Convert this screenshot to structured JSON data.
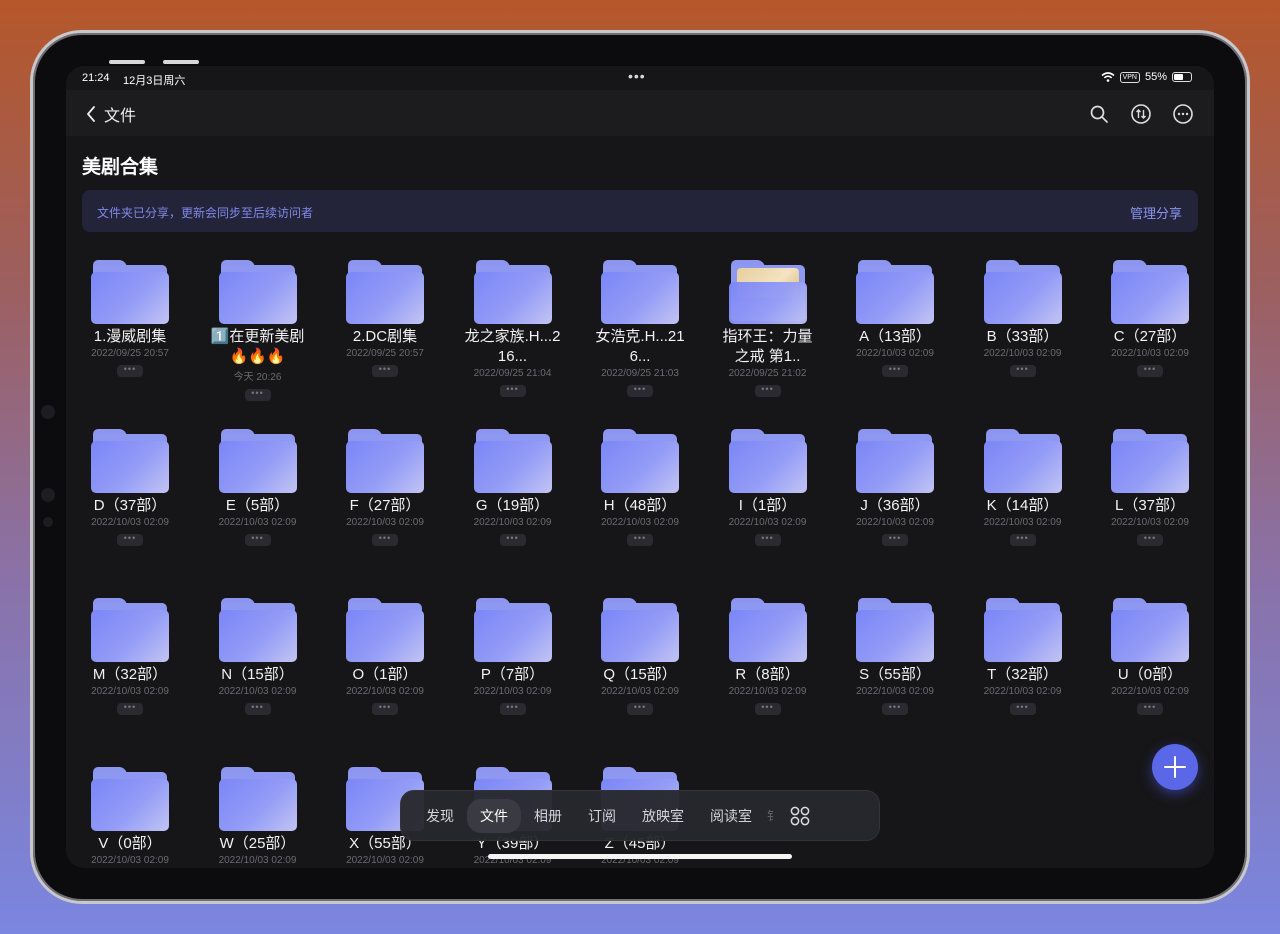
{
  "status": {
    "time": "21:24",
    "date": "12月3日周六",
    "vpn": "VPN",
    "battery": "55%"
  },
  "nav": {
    "back_label": "文件"
  },
  "page": {
    "title": "美剧合集"
  },
  "share": {
    "notice": "文件夹已分享，更新会同步至后续访问者",
    "manage": "管理分享"
  },
  "folders": [
    {
      "name": "1.漫威剧集",
      "date": "2022/09/25 20:57"
    },
    {
      "name": "1️⃣在更新美剧🔥🔥🔥",
      "date": "今天 20:26"
    },
    {
      "name": "2.DC剧集",
      "date": "2022/09/25 20:57"
    },
    {
      "name": "龙之家族.H...216...",
      "date": "2022/09/25 21:04"
    },
    {
      "name": "女浩克.H...216...",
      "date": "2022/09/25 21:03"
    },
    {
      "name": "指环王：力量之戒 第1..",
      "date": "2022/09/25 21:02",
      "photo": true
    },
    {
      "name": "A（13部）",
      "date": "2022/10/03 02:09"
    },
    {
      "name": "B（33部）",
      "date": "2022/10/03 02:09"
    },
    {
      "name": "C（27部）",
      "date": "2022/10/03 02:09"
    },
    {
      "name": "D（37部）",
      "date": "2022/10/03 02:09"
    },
    {
      "name": "E（5部）",
      "date": "2022/10/03 02:09"
    },
    {
      "name": "F（27部）",
      "date": "2022/10/03 02:09"
    },
    {
      "name": "G（19部）",
      "date": "2022/10/03 02:09"
    },
    {
      "name": "H（48部）",
      "date": "2022/10/03 02:09"
    },
    {
      "name": "I（1部）",
      "date": "2022/10/03 02:09"
    },
    {
      "name": "J（36部）",
      "date": "2022/10/03 02:09"
    },
    {
      "name": "K（14部）",
      "date": "2022/10/03 02:09"
    },
    {
      "name": "L（37部）",
      "date": "2022/10/03 02:09"
    },
    {
      "name": "M（32部）",
      "date": "2022/10/03 02:09"
    },
    {
      "name": "N（15部）",
      "date": "2022/10/03 02:09"
    },
    {
      "name": "O（1部）",
      "date": "2022/10/03 02:09"
    },
    {
      "name": "P（7部）",
      "date": "2022/10/03 02:09"
    },
    {
      "name": "Q（15部）",
      "date": "2022/10/03 02:09"
    },
    {
      "name": "R（8部）",
      "date": "2022/10/03 02:09"
    },
    {
      "name": "S（55部）",
      "date": "2022/10/03 02:09"
    },
    {
      "name": "T（32部）",
      "date": "2022/10/03 02:09"
    },
    {
      "name": "U（0部）",
      "date": "2022/10/03 02:09"
    },
    {
      "name": "V（0部）",
      "date": "2022/10/03 02:09"
    },
    {
      "name": "W（25部）",
      "date": "2022/10/03 02:09"
    },
    {
      "name": "X（55部）",
      "date": "2022/10/03 02:09"
    },
    {
      "name": "Y（39部）",
      "date": "2022/10/03 02:09"
    },
    {
      "name": "Z（45部）",
      "date": "2022/10/03 02:09"
    }
  ],
  "tabs": [
    "发现",
    "文件",
    "相册",
    "订阅",
    "放映室",
    "阅读室"
  ],
  "tab_partial": "钅",
  "active_tab": "文件",
  "colors": {
    "accent": "#5a67e6",
    "folder": "#8c95ef",
    "share_text": "#7f8ae8"
  }
}
